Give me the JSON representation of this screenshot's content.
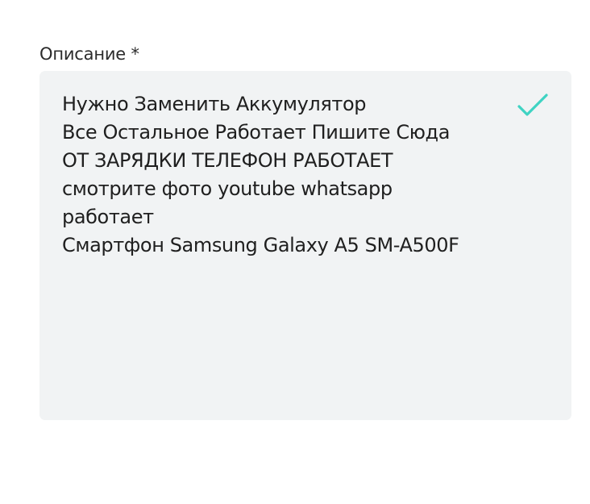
{
  "description_field": {
    "label": "Описание *",
    "lines": [
      "Нужно Заменить Аккумулятор",
      "Все Остальное Работает Пишите Сюда",
      "ОТ ЗАРЯДКИ ТЕЛЕФОН РАБОТАЕТ",
      "смотрите фото youtube whatsapp",
      "работает",
      "Смартфон Samsung Galaxy A5 SM-A500F"
    ],
    "valid_icon": "checkmark-icon",
    "accent_color": "#3fd3c3"
  }
}
